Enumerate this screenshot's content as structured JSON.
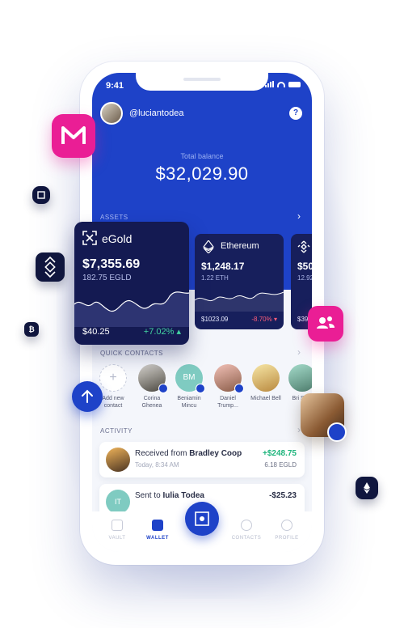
{
  "status": {
    "time": "9:41"
  },
  "header": {
    "username": "@luciantodea",
    "help": "?"
  },
  "balance": {
    "label": "Total balance",
    "value": "$32,029.90"
  },
  "assets": {
    "label": "ASSETS",
    "cards": [
      {
        "name": "eGold",
        "value": "$7,355.69",
        "amount": "182.75 EGLD",
        "footer": "$40.25",
        "change": "+7.02%"
      },
      {
        "name": "Ethereum",
        "value": "$1,248.17",
        "amount": "1.22 ETH",
        "footer": "$1023.09",
        "change": "-8.70%"
      },
      {
        "name": "",
        "value": "$50",
        "amount": "12.92",
        "footer": "$39",
        "change": ""
      }
    ]
  },
  "quick_contacts": {
    "label": "QUICK CONTACTS",
    "items": [
      {
        "name": "Add new contact"
      },
      {
        "name": "Corina Ghenea"
      },
      {
        "name": "Beniamin Mincu",
        "initials": "BM"
      },
      {
        "name": "Daniel Trump..."
      },
      {
        "name": "Michael Bell"
      },
      {
        "name": "Bri Sh..."
      }
    ]
  },
  "activity": {
    "label": "ACTIVITY",
    "transactions": [
      {
        "prefix": "Received from ",
        "party": "Bradley Coop",
        "date": "Today, 8:34 AM",
        "amount": "+$248.75",
        "token": "6.18 EGLD",
        "amount_color": "#1fb57d"
      },
      {
        "prefix": "Sent to ",
        "party": "Iulia Todea",
        "initials": "IT",
        "amount": "-$25.23",
        "amount_color": "#2a2f47"
      }
    ]
  },
  "nav": {
    "vault": "VAULT",
    "wallet": "WALLET",
    "contacts": "CONTACTS",
    "profile": "PROFILE"
  },
  "colors": {
    "primary": "#1e42c8",
    "accent": "#ea1e95",
    "card": "#141a52",
    "positive": "#43d3a1",
    "negative": "#ff5e7a"
  }
}
